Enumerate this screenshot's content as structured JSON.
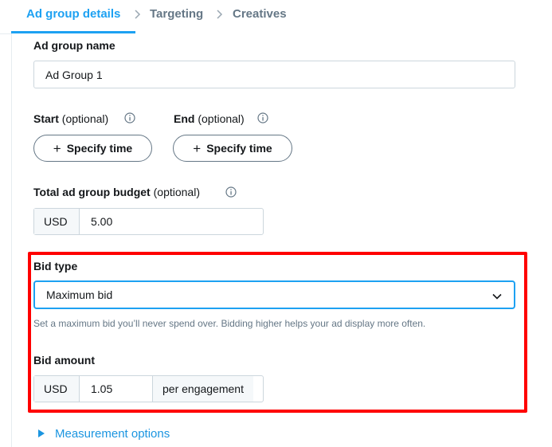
{
  "tabs": [
    {
      "label": "Ad group details",
      "active": true
    },
    {
      "label": "Targeting",
      "active": false
    },
    {
      "label": "Creatives",
      "active": false
    }
  ],
  "ad_group_name": {
    "label": "Ad group name",
    "value": "Ad Group 1"
  },
  "start": {
    "label": "Start",
    "optional": "(optional)",
    "button": "Specify time"
  },
  "end": {
    "label": "End",
    "optional": "(optional)",
    "button": "Specify time"
  },
  "budget": {
    "label": "Total ad group budget",
    "optional": "(optional)",
    "currency": "USD",
    "value": "5.00"
  },
  "bid_type": {
    "label": "Bid type",
    "selected": "Maximum bid",
    "help": "Set a maximum bid you’ll never spend over. Bidding higher helps your ad display more often."
  },
  "bid_amount": {
    "label": "Bid amount",
    "currency": "USD",
    "value": "1.05",
    "unit": "per engagement"
  },
  "measurement": {
    "label": "Measurement options"
  },
  "colors": {
    "accent": "#1da1f2",
    "highlight": "#ff0000",
    "muted": "#657786"
  },
  "icons": {
    "info": "info-icon",
    "chevron": "chevron-down-icon",
    "caret": "caret-right-icon",
    "plus": "plus-icon"
  }
}
